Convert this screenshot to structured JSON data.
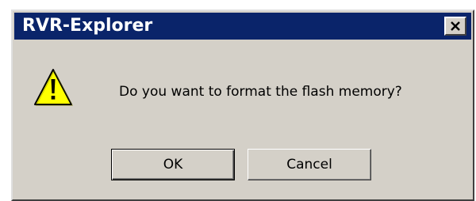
{
  "window": {
    "title": "RVR-Explorer",
    "close_icon": "close-icon"
  },
  "dialog": {
    "icon": "warning-icon",
    "message": "Do you want to format the flash memory?"
  },
  "buttons": {
    "ok_label": "OK",
    "cancel_label": "Cancel"
  },
  "colors": {
    "titlebar": "#0a246a",
    "face": "#d4d0c8",
    "warning_fill": "#ffff00"
  }
}
